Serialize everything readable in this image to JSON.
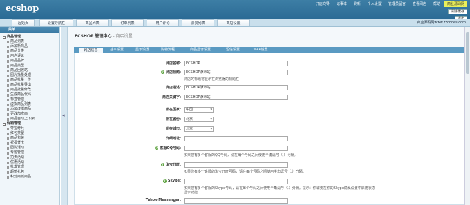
{
  "header": {
    "logo": "ecshop",
    "links": [
      "开店向导",
      "记事本",
      "刷新",
      "个人设置",
      "管理员留言",
      "查看网店",
      "帮助",
      "商业源码网"
    ],
    "buttons": [
      "清除缓存",
      "退出"
    ]
  },
  "nav": {
    "tabs": [
      "起始页",
      "设置导航栏",
      "商品列表",
      "订单列表",
      "用户评论",
      "会员列表",
      "商店设置"
    ],
    "site": "商业源码网www.zzcodes.com"
  },
  "sidebar": {
    "title": "菜单",
    "groups": [
      {
        "label": "商品管理",
        "items": [
          "商品列表",
          "添加新商品",
          "商品分类",
          "用户评论",
          "商品品牌",
          "商品类型",
          "商品回收站",
          "图片批量处理",
          "商品批量上传",
          "商品批量导出",
          "商品批量修改",
          "生成商品代码",
          "标签管理",
          "虚拟商品列表",
          "添加虚拟商品",
          "更改加密串",
          "商品自动上下架"
        ]
      },
      {
        "label": "促销管理",
        "items": [
          "夺宝奇兵",
          "红包类型",
          "商品包装",
          "祝福贺卡",
          "团购活动",
          "专题管理",
          "拍卖活动",
          "优惠活动",
          "批发管理",
          "超值礼包",
          "积分商城商品"
        ]
      }
    ]
  },
  "main": {
    "title": "ECSHOP 管理中心",
    "subtitle": " - 商店设置",
    "tabs": [
      "网店信息",
      "基本设置",
      "显示设置",
      "购物流程",
      "商品显示设置",
      "短信设置",
      "WAP设置"
    ],
    "fields": {
      "shop_name": {
        "label": "商店名称:",
        "value": "ECSHOP"
      },
      "shop_title": {
        "label": "商店标题:",
        "value": "ECSHOP演示站",
        "note": "商店的标题将显示在浏览器的标题栏"
      },
      "shop_desc": {
        "label": "商店描述:",
        "value": "ECSHOP演示站"
      },
      "shop_keywords": {
        "label": "商店关键字:",
        "value": "ECSHOP演示站"
      },
      "country": {
        "label": "所在国家:",
        "value": "中国"
      },
      "province": {
        "label": "所在省份:",
        "value": "北京"
      },
      "city": {
        "label": "所在城市:",
        "value": "北京"
      },
      "address": {
        "label": "详细地址:",
        "value": ""
      },
      "qq": {
        "label": "客服QQ号码:",
        "value": "",
        "note": "如果您有多个客服的QQ号码，请在每个号码之间使用半角逗号（,）分隔。"
      },
      "ww": {
        "label": "淘宝旺旺:",
        "value": "",
        "note": "如果您有多个客服的淘宝旺旺号码，请在每个号码之间使用半角逗号（,）分隔。"
      },
      "skype": {
        "label": "Skype:",
        "value": "",
        "note": "如果您有多个客服的Skype号码，请在每个号码之间使用半角逗号（,）分隔。提示：你需要在你的Skype隐私设置中启用状态",
        "note2": "显示功能"
      },
      "yahoo": {
        "label": "Yahoo Messenger:",
        "value": ""
      }
    }
  },
  "colors": {
    "topbar": "#2e6f98",
    "tabbar": "#5a9ac2",
    "highlight": "#e9f05a",
    "help_icon": "#5aa13c"
  }
}
